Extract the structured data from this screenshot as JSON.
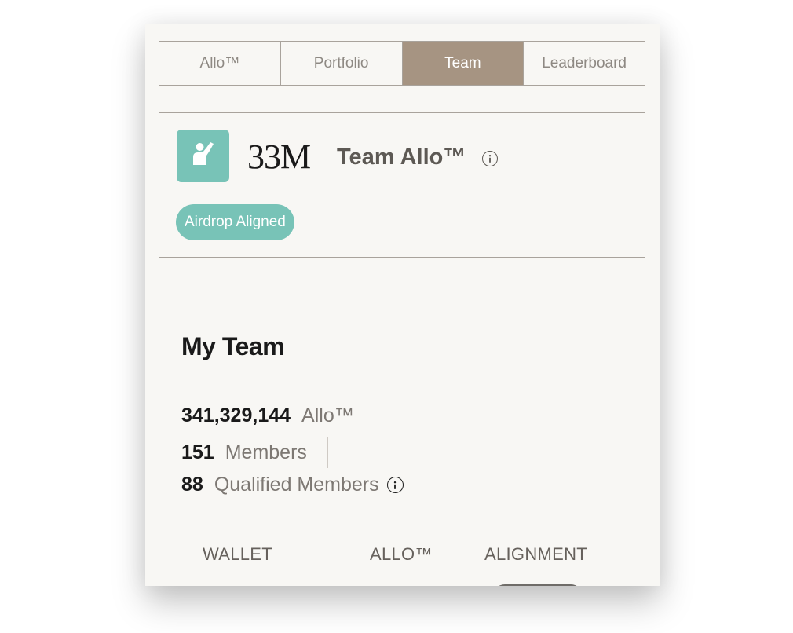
{
  "tabs": [
    {
      "label": "Allo™",
      "active": false
    },
    {
      "label": "Portfolio",
      "active": false
    },
    {
      "label": "Team",
      "active": true
    },
    {
      "label": "Leaderboard",
      "active": false
    }
  ],
  "team": {
    "count": "33M",
    "name": "Team Allo™",
    "badge": "Airdrop Aligned",
    "avatar_icon": "person-raising-hand-icon",
    "accent": "#78c3b7"
  },
  "my_team": {
    "title": "My Team",
    "stats": [
      {
        "value": "341,329,144",
        "label": "Allo™"
      },
      {
        "value": "151",
        "label": "Members"
      },
      {
        "value": "88",
        "label": "Qualified Members"
      }
    ],
    "table": {
      "columns": [
        "WALLET",
        "ALLO™",
        "ALIGNMENT"
      ]
    }
  },
  "colors": {
    "active_tab": "#a69482",
    "panel_bg": "#f8f7f4",
    "border": "#a9a39c"
  }
}
